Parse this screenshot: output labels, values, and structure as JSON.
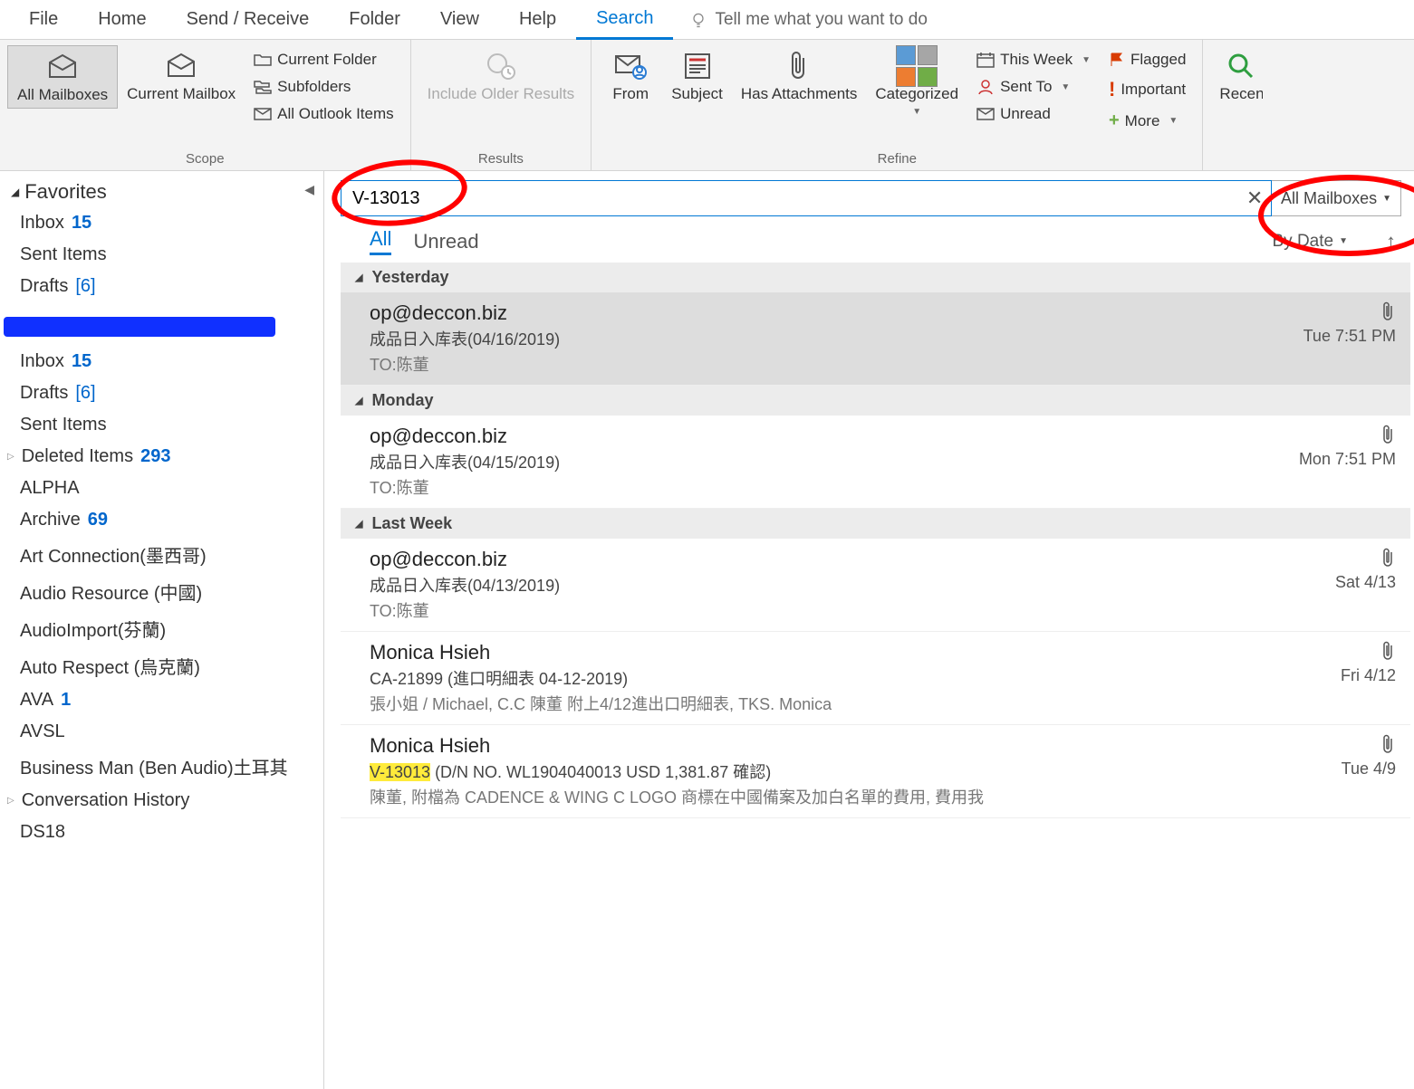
{
  "ribbon_tabs": [
    "File",
    "Home",
    "Send / Receive",
    "Folder",
    "View",
    "Help",
    "Search"
  ],
  "active_tab": "Search",
  "tell_me": "Tell me what you want to do",
  "ribbon": {
    "scope": {
      "label": "Scope",
      "all_mailboxes": "All Mailboxes",
      "current_mailbox": "Current Mailbox",
      "current_folder": "Current Folder",
      "subfolders": "Subfolders",
      "all_outlook_items": "All Outlook Items"
    },
    "results": {
      "label": "Results",
      "include_older": "Include Older Results"
    },
    "refine": {
      "label": "Refine",
      "from": "From",
      "subject": "Subject",
      "has_attachments": "Has Attachments",
      "categorized": "Categorized",
      "this_week": "This Week",
      "sent_to": "Sent To",
      "unread": "Unread",
      "flagged": "Flagged",
      "important": "Important",
      "more": "More"
    },
    "close": {
      "recent": "Recent Searches"
    }
  },
  "nav": {
    "favorites": "Favorites",
    "fav_items": [
      {
        "label": "Inbox",
        "count": "15",
        "count_style": "bold"
      },
      {
        "label": "Sent Items"
      },
      {
        "label": "Drafts",
        "bracket": "[6]"
      }
    ],
    "account_items": [
      {
        "label": "Inbox",
        "count": "15",
        "count_style": "bold"
      },
      {
        "label": "Drafts",
        "bracket": "[6]"
      },
      {
        "label": "Sent Items"
      },
      {
        "label": "Deleted Items",
        "count": "293",
        "count_style": "bold",
        "expandable": true
      },
      {
        "label": "ALPHA"
      },
      {
        "label": "Archive",
        "count": "69",
        "count_style": "bold"
      },
      {
        "label": "Art Connection(墨西哥)"
      },
      {
        "label": "Audio Resource (中國)"
      },
      {
        "label": "AudioImport(芬蘭)"
      },
      {
        "label": "Auto Respect (烏克蘭)"
      },
      {
        "label": "AVA",
        "count": "1",
        "count_style": "bold"
      },
      {
        "label": "AVSL"
      },
      {
        "label": "Business Man (Ben Audio)土耳其"
      },
      {
        "label": "Conversation History",
        "expandable": true
      },
      {
        "label": "DS18"
      }
    ]
  },
  "search": {
    "query": "V-13013",
    "scope": "All Mailboxes"
  },
  "filters": {
    "all": "All",
    "unread": "Unread",
    "sort": "By Date"
  },
  "groups": [
    {
      "name": "Yesterday",
      "messages": [
        {
          "sender": "op@deccon.biz",
          "subject": "成品日入库表(04/16/2019)",
          "preview": "TO:陈董",
          "time": "Tue 7:51 PM",
          "attach": true,
          "selected": true
        }
      ]
    },
    {
      "name": "Monday",
      "messages": [
        {
          "sender": "op@deccon.biz",
          "subject": "成品日入库表(04/15/2019)",
          "preview": "TO:陈董",
          "time": "Mon 7:51 PM",
          "attach": true
        }
      ]
    },
    {
      "name": "Last Week",
      "messages": [
        {
          "sender": "op@deccon.biz",
          "subject": "成品日入库表(04/13/2019)",
          "preview": "TO:陈董",
          "time": "Sat 4/13",
          "attach": true
        },
        {
          "sender": "Monica Hsieh",
          "subject": "CA-21899  (進口明細表 04-12-2019)",
          "preview": "張小姐 / Michael,                      C.C 陳董   附上4/12進出口明細表, TKS.  Monica",
          "time": "Fri 4/12",
          "attach": true
        },
        {
          "sender": "Monica Hsieh",
          "subject_hl": "V-13013",
          "subject_rest": "  (D/N NO. WL1904040013 USD 1,381.87 確認)",
          "preview": "陳董,  附檔為 CADENCE & WING C LOGO 商標在中國備案及加白名單的費用, 費用我",
          "time": "Tue 4/9",
          "attach": true
        }
      ]
    }
  ]
}
